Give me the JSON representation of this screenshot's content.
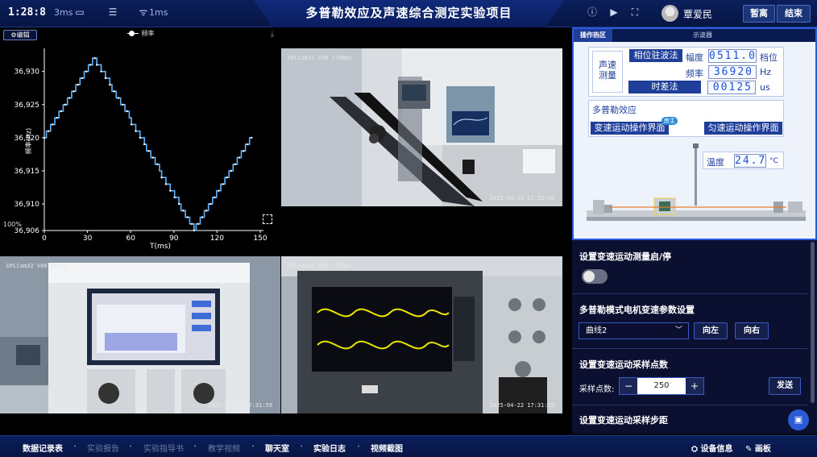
{
  "header": {
    "timer": "1:28:8",
    "latency_1": "3ms",
    "latency_2": "1ms",
    "title": "多普勒效应及声速综合测定实验项目",
    "user_name": "覃爱民",
    "pause_label": "暂离",
    "end_label": "结束"
  },
  "chart": {
    "edit_label": "⚙编辑",
    "percent_label": "100%"
  },
  "chart_data": {
    "type": "line",
    "series": [
      {
        "name": "频率",
        "values": []
      }
    ],
    "xlabel": "T(ms)",
    "ylabel": "频率(Hz)",
    "xlim": [
      0,
      150
    ],
    "ylim": [
      36906,
      36933
    ],
    "xticks": [
      0,
      30,
      60,
      90,
      120,
      150
    ],
    "yticks": [
      "36,906",
      "36,910",
      "36,915",
      "36,920",
      "36,925",
      "36,930"
    ],
    "peak": {
      "x": 35,
      "y": 36932
    },
    "trough": {
      "x": 104,
      "y": 36906
    },
    "start": {
      "x": 0,
      "y": 36920
    },
    "end": {
      "x": 144,
      "y": 36920
    }
  },
  "cameras": [
    {
      "label": "DPLCam31 V88 17KBps",
      "timestamp": "2025-04-22  17:31:59"
    },
    {
      "label": "DPLCam32 V88 8KBps",
      "timestamp": "2025-04-22  17:31:59"
    },
    {
      "label": "DPLCam33 V88 17KBps",
      "timestamp": "2025-04-22  17:31:59"
    }
  ],
  "right_panel": {
    "tab_active": "操作热区",
    "tab_other": "示波器",
    "sound_speed_label": "声速\n测量",
    "phase_method": "相位驻波法",
    "amplitude_label": "幅度",
    "amplitude_value": "0511.0",
    "amplitude_unit": "档位",
    "frequency_label": "频率",
    "frequency_value": "36920",
    "frequency_unit": "Hz",
    "time_diff_label": "时差法",
    "time_diff_value": "00125",
    "time_diff_unit": "us",
    "doppler_label": "多普勒效应",
    "var_ui_label": "变速运动操作界面",
    "var_ui_badge": "房主",
    "const_ui_label": "匀速运动操作界面",
    "temp_label": "温度",
    "temp_value": "24.7",
    "temp_unit": "°C"
  },
  "settings": {
    "sec1_title": "设置变速运动测量启/停",
    "sec2_title": "多普勒模式电机变速参数设置",
    "select_value": "曲线2",
    "left_label": "向左",
    "right_label": "向右",
    "sec3_title": "设置变速运动采样点数",
    "sample_label": "采样点数:",
    "sample_value": "250",
    "send_label": "发送",
    "sec4_title": "设置变速运动采样步距"
  },
  "bottom_nav": [
    {
      "label": "数据记录表",
      "active": true
    },
    {
      "label": "实验报告",
      "active": false
    },
    {
      "label": "实验指导书",
      "active": false
    },
    {
      "label": "教学视频",
      "active": false
    },
    {
      "label": "聊天室",
      "active": true
    },
    {
      "label": "实验日志",
      "active": true
    },
    {
      "label": "视频截图",
      "active": true
    }
  ],
  "bottom_right": {
    "device_info": "设备信息",
    "canvas": "画板"
  },
  "colors": {
    "accent": "#2b5bd6",
    "line": "#5fb4ff",
    "digits": "#1e4fd6"
  }
}
